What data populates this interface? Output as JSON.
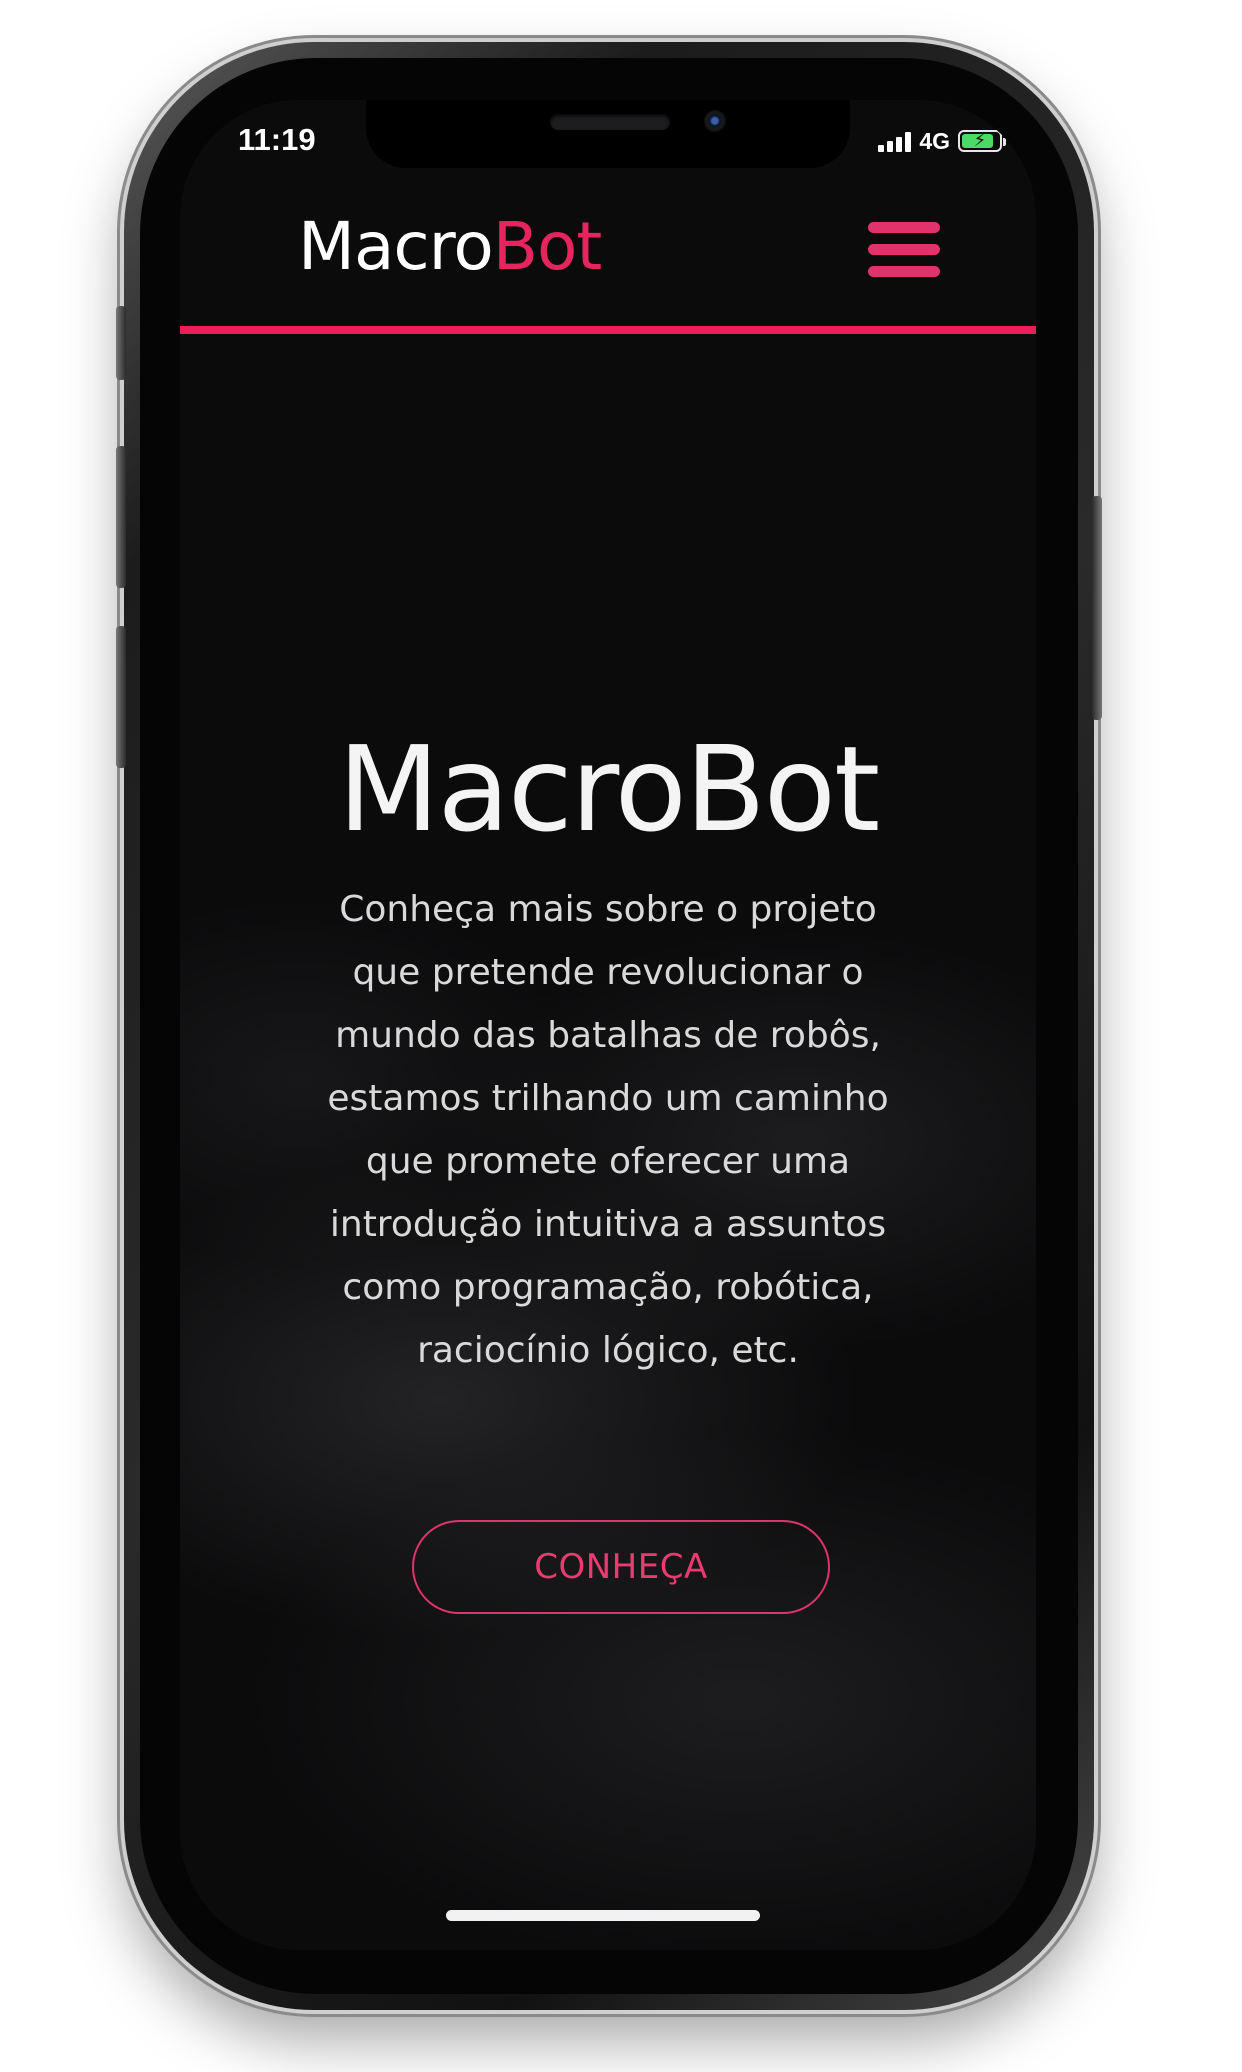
{
  "status_bar": {
    "time": "11:19",
    "network": "4G",
    "battery_charging": true,
    "battery_level": 0.85
  },
  "header": {
    "brand_prefix": "Macro",
    "brand_accent": "Bot",
    "menu_icon": "hamburger-menu-icon"
  },
  "hero": {
    "title": "MacroBot",
    "lines": [
      "Conheça mais sobre o projeto",
      "que pretende revolucionar o",
      "mundo das batalhas de robôs,",
      "estamos trilhando um caminho",
      "que promete oferecer uma",
      "introdução intuitiva a assuntos",
      "como programação, robótica,",
      "raciocínio lógico, etc."
    ],
    "cta_label": "CONHEÇA"
  },
  "colors": {
    "accent": "#e8245e",
    "background": "#0b0b0c",
    "text": "#f4f4f4"
  }
}
